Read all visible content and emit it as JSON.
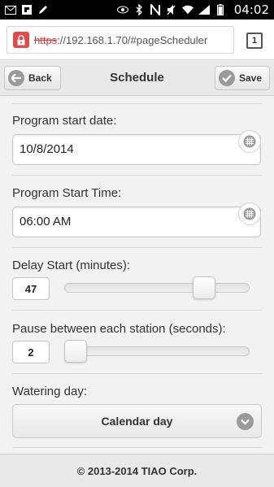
{
  "status_bar": {
    "time": "04:02",
    "icons": [
      "mail-icon",
      "flipboard-icon",
      "pen-icon",
      "eye-icon",
      "bluetooth-icon",
      "nfc-icon",
      "mute-icon",
      "wifi-icon",
      "signal-icon",
      "battery-icon"
    ]
  },
  "browser": {
    "url_protocol": "https",
    "url_rest": "://192.168.1.70/#pageScheduler",
    "tab_count": "1"
  },
  "header": {
    "title": "Schedule",
    "back_label": "Back",
    "save_label": "Save"
  },
  "form": {
    "start_date_label": "Program start date:",
    "start_date_value": "10/8/2014",
    "start_time_label": "Program Start Time:",
    "start_time_value": "06:00 AM",
    "delay_label": "Delay Start (minutes):",
    "delay_value": "47",
    "delay_fraction": 0.79,
    "pause_label": "Pause between each station (seconds):",
    "pause_value": "2",
    "pause_fraction": 0.0,
    "watering_label": "Watering day:",
    "watering_value": "Calendar day"
  },
  "footer": {
    "copyright": "© 2013-2014 TIAO Corp."
  },
  "colors": {
    "lock_red": "#e04a4a",
    "header_bg": "#e9e9e9",
    "icon_gray": "#9a9a9a"
  }
}
